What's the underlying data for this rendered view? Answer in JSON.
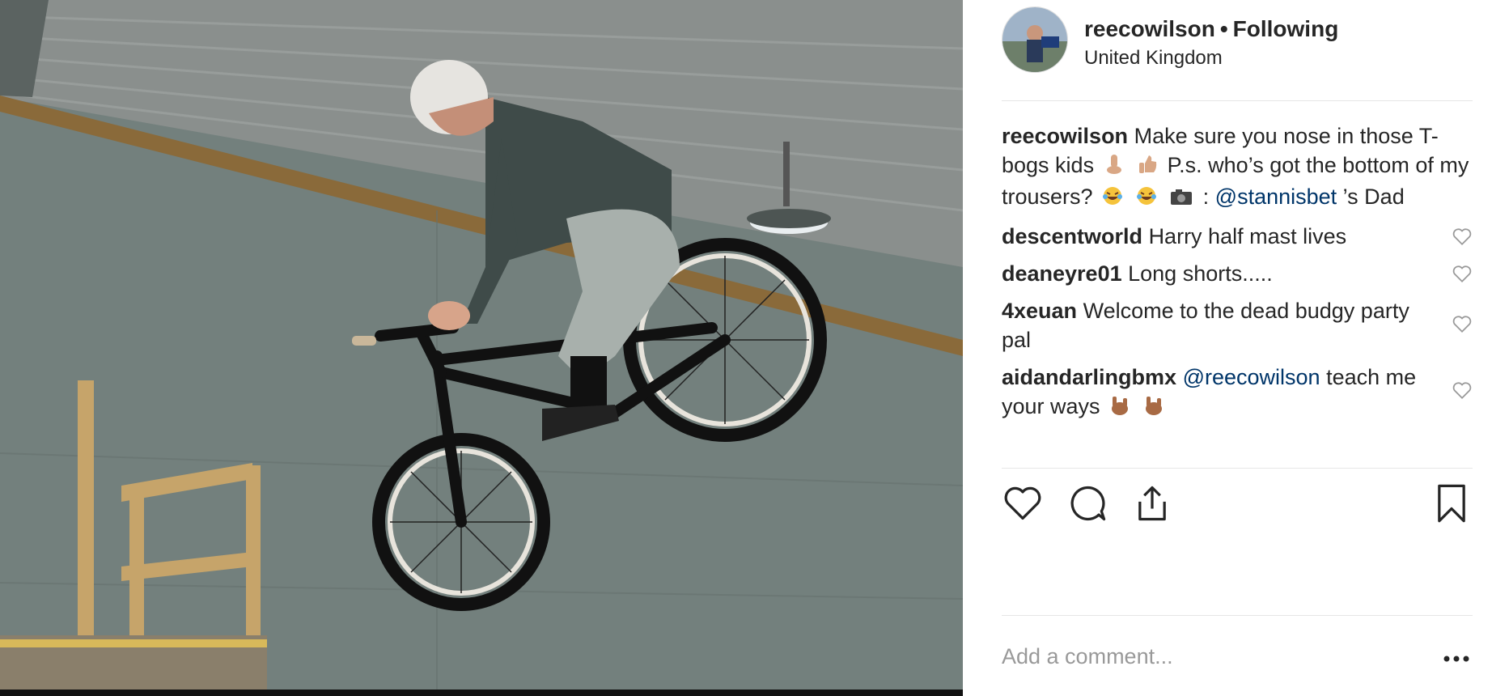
{
  "post": {
    "username": "reecowilson",
    "separator": "•",
    "follow_status": "Following",
    "location": "United Kingdom"
  },
  "caption": {
    "username": "reecowilson",
    "text_1": "Make sure you nose in those T-bogs kids",
    "text_2": "P.s. who’s got the bottom of my trousers?",
    "text_3": ":",
    "mention": "@stannisbet",
    "text_4": "’s Dad"
  },
  "comments": [
    {
      "username": "descentworld",
      "text": "Harry half mast lives"
    },
    {
      "username": "deaneyre01",
      "text": "Long shorts....."
    },
    {
      "username": "4xeuan",
      "text": "Welcome to the dead budgy party pal"
    },
    {
      "username": "aidandarlingbmx",
      "mention": "@reecowilson",
      "text": "teach me your ways"
    }
  ],
  "icons": {
    "like": "heart-icon",
    "comment": "speech-bubble-icon",
    "share": "share-icon",
    "save": "bookmark-icon",
    "more": "ellipsis-icon",
    "comment_like": "heart-outline-icon"
  },
  "composer": {
    "placeholder": "Add a comment..."
  },
  "colors": {
    "text": "#262626",
    "mention": "#003569",
    "muted": "#999999",
    "border": "#e6e6e6"
  }
}
